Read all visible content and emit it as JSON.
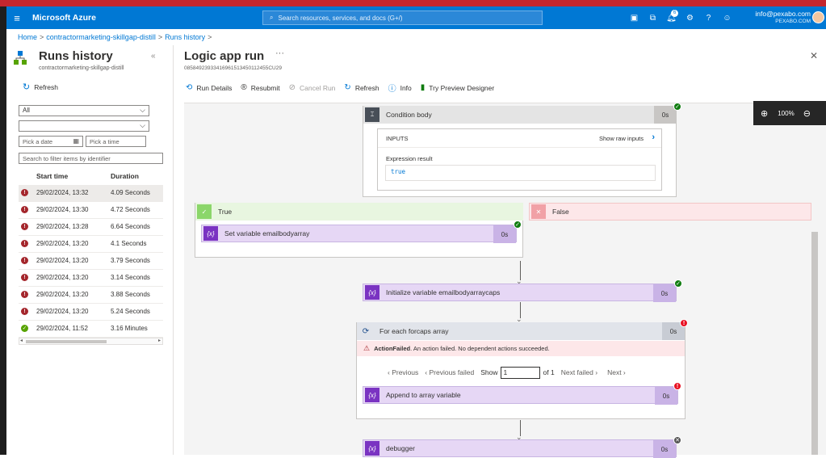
{
  "app": {
    "brand": "Microsoft Azure"
  },
  "search": {
    "placeholder": "Search resources, services, and docs (G+/)"
  },
  "notifications": {
    "count": "6"
  },
  "account": {
    "email": "info@pexabo.com",
    "directory": "PEXABO.COM"
  },
  "breadcrumb": [
    "Home",
    "contractormarketing-skillgap-distill",
    "Runs history"
  ],
  "left": {
    "title": "Runs history",
    "subtitle": "contractormarketing-skillgap-distill",
    "refresh": "Refresh",
    "status_filter": "All",
    "second_filter": "",
    "date_placeholder": "Pick a date",
    "time_placeholder": "Pick a time",
    "identifier_placeholder": "Search to filter items by identifier",
    "col_start": "Start time",
    "col_duration": "Duration",
    "runs": [
      {
        "status": "failed",
        "start": "29/02/2024, 13:32",
        "duration": "4.09 Seconds"
      },
      {
        "status": "failed",
        "start": "29/02/2024, 13:30",
        "duration": "4.72 Seconds"
      },
      {
        "status": "failed",
        "start": "29/02/2024, 13:28",
        "duration": "6.64 Seconds"
      },
      {
        "status": "failed",
        "start": "29/02/2024, 13:20",
        "duration": "4.1 Seconds"
      },
      {
        "status": "failed",
        "start": "29/02/2024, 13:20",
        "duration": "3.79 Seconds"
      },
      {
        "status": "failed",
        "start": "29/02/2024, 13:20",
        "duration": "3.14 Seconds"
      },
      {
        "status": "failed",
        "start": "29/02/2024, 13:20",
        "duration": "3.88 Seconds"
      },
      {
        "status": "failed",
        "start": "29/02/2024, 13:20",
        "duration": "5.24 Seconds"
      },
      {
        "status": "succeeded",
        "start": "29/02/2024, 11:52",
        "duration": "3.16 Minutes"
      }
    ]
  },
  "main": {
    "title": "Logic app run",
    "run_id": "08584923933416961513450112455CU29",
    "toolbar": {
      "run_details": "Run Details",
      "resubmit": "Resubmit",
      "cancel_run": "Cancel Run",
      "refresh": "Refresh",
      "info": "Info",
      "preview": "Try Preview Designer"
    },
    "zoom": "100%",
    "condition": {
      "title": "Condition body",
      "duration": "0s",
      "inputs_label": "INPUTS",
      "show_raw": "Show raw inputs",
      "expr_label": "Expression result",
      "expr_value": "true"
    },
    "true_branch": {
      "label": "True"
    },
    "false_branch": {
      "label": "False"
    },
    "set_var": {
      "title": "Set variable emailbodyarray",
      "duration": "0s"
    },
    "init_var": {
      "title": "Initialize variable emailbodyarraycaps",
      "duration": "0s"
    },
    "foreach": {
      "title": "For each forcaps array",
      "duration": "0s",
      "error_title": "ActionFailed",
      "error_msg": ". An action failed. No dependent actions succeeded.",
      "previous": "Previous",
      "previous_failed": "Previous failed",
      "show": "Show",
      "page": "1",
      "of": "of 1",
      "next_failed": "Next failed",
      "next": "Next"
    },
    "append": {
      "title": "Append to array variable",
      "duration": "0s"
    },
    "debugger": {
      "title": "debugger",
      "duration": "0s"
    },
    "colors": {
      "azure_blue": "#0078d4",
      "variable_purple": "#e6d7f5",
      "variable_icon": "#7a33c2",
      "success": "#107c10",
      "failure": "#e81123"
    }
  }
}
